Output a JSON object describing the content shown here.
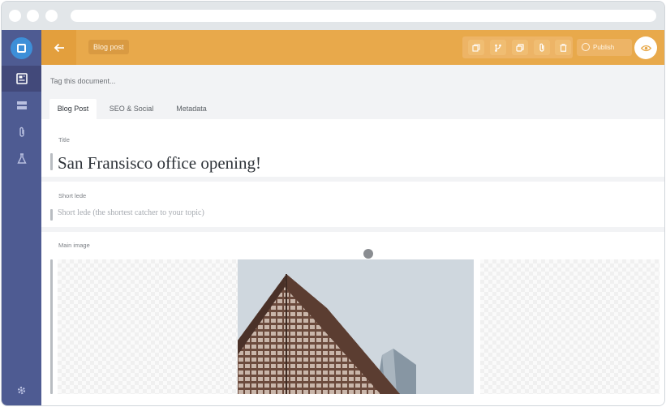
{
  "topbar": {
    "document_type": "Blog post",
    "publish_label": "Publish",
    "toolbar_icons": [
      "duplicate-icon",
      "branch-icon",
      "copy-icon",
      "attach-icon",
      "trash-icon"
    ]
  },
  "sidebar": {
    "items": [
      {
        "icon": "documents-icon",
        "active": true
      },
      {
        "icon": "layout-icon",
        "active": false
      },
      {
        "icon": "paperclip-icon",
        "active": false
      },
      {
        "icon": "flask-icon",
        "active": false
      }
    ],
    "footer_icon": "gear-icon"
  },
  "editor": {
    "tag_placeholder": "Tag this document...",
    "tabs": [
      {
        "label": "Blog Post",
        "active": true
      },
      {
        "label": "SEO & Social",
        "active": false
      },
      {
        "label": "Metadata",
        "active": false
      }
    ],
    "fields": {
      "title_label": "Title",
      "title_value": "San Fransisco office opening!",
      "lede_label": "Short lede",
      "lede_placeholder": "Short lede (the shortest catcher to your topic)",
      "image_label": "Main image"
    }
  },
  "colors": {
    "topbar": "#e8a94b",
    "sidebar": "#4e5b92",
    "accent": "#3d8fd8"
  }
}
